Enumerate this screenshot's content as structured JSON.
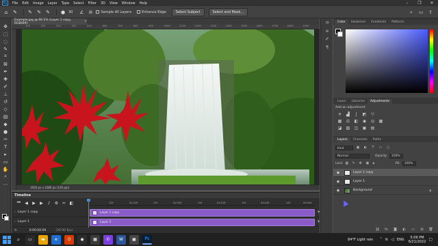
{
  "menubar": {
    "logo": "Ps",
    "items": [
      "File",
      "Edit",
      "Image",
      "Layer",
      "Type",
      "Select",
      "Filter",
      "3D",
      "View",
      "Window",
      "Help"
    ],
    "window_controls": [
      "–",
      "❐",
      "✕"
    ]
  },
  "options_bar": {
    "brush_size": "30",
    "sample_all_layers": "Sample All Layers",
    "enhance_edge": "Enhance Edge",
    "select_subject": "Select Subject",
    "select_and_mask": "Select and Mask..."
  },
  "document": {
    "tab_title": "Example.jpg @ 66.1% (Layer 1 copy, RGB/8#)",
    "status": "1920 px x 1080 px (120 ppi)",
    "ruler_ticks": [
      "100",
      "200",
      "300",
      "400",
      "500",
      "600",
      "700",
      "800",
      "900",
      "1000",
      "1100",
      "1200",
      "1300",
      "1400",
      "1500",
      "1600",
      "1700",
      "1800",
      "1900"
    ]
  },
  "timeline": {
    "title": "Timeline",
    "ruler": [
      "15f",
      "01:00f",
      "15f",
      "02:00f",
      "15f",
      "03:00f",
      "15f",
      "04:00f",
      "15f",
      "05:00f"
    ],
    "tracks": [
      {
        "label": "Layer 1 copy",
        "clip": "Layer 1 copy"
      },
      {
        "label": "Layer 1",
        "clip": "Layer 1"
      }
    ],
    "current_time": "0:00:00:00",
    "fps": "(30.00 fps)"
  },
  "color_panel": {
    "tabs": [
      "Color",
      "Swatches",
      "Gradients",
      "Patterns"
    ],
    "fg": "#000000",
    "bg": "#ffffff"
  },
  "adjustments_panel": {
    "tabs": [
      "Learn",
      "Libraries",
      "Adjustments"
    ],
    "add_label": "Add an adjustment"
  },
  "layers_panel": {
    "tabs": [
      "Layers",
      "Channels",
      "Paths"
    ],
    "kind": "Kind",
    "blend_mode": "Normal",
    "opacity_label": "Opacity:",
    "opacity": "100%",
    "lock_label": "Lock:",
    "fill_label": "Fill:",
    "fill": "100%",
    "layers": [
      {
        "name": "Layer 1 copy",
        "selected": true,
        "italic": false
      },
      {
        "name": "Layer 1",
        "selected": false,
        "italic": false
      },
      {
        "name": "Background",
        "selected": false,
        "italic": true
      }
    ]
  },
  "taskbar": {
    "weather": "84°F  Light rain",
    "lang": "ENG",
    "time": "5:06 PM",
    "date": "6/21/2022"
  },
  "colors": {
    "accent": "#31a8ff",
    "clip": "#8a5cc7",
    "panel_bg": "#424242"
  }
}
